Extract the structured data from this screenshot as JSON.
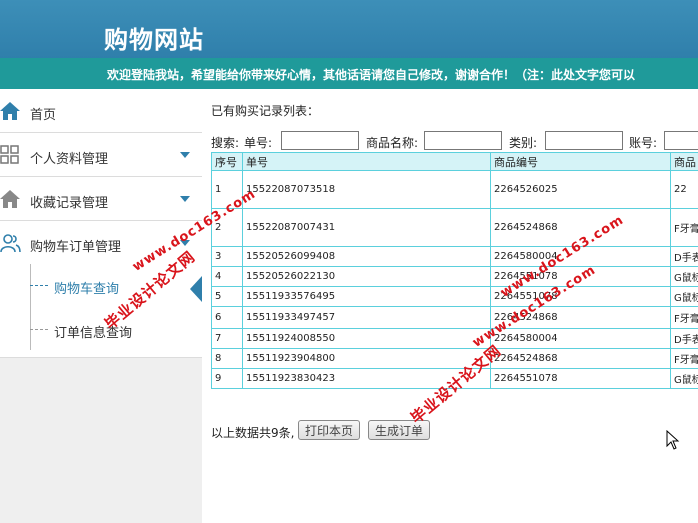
{
  "header": {
    "site_title": "购物网站"
  },
  "marquee": {
    "text": "欢迎登陆我站，希望能给你带来好心情，其他话语请您自己修改，谢谢合作！（注：此处文字您可以"
  },
  "sidebar": {
    "items": [
      {
        "label": "首页",
        "icon": "home-icon"
      },
      {
        "label": "个人资料管理",
        "icon": "grid-icon"
      },
      {
        "label": "收藏记录管理",
        "icon": "home-icon"
      },
      {
        "label": "购物车订单管理",
        "icon": "users-icon"
      }
    ],
    "sub_items": [
      {
        "label": "购物车查询",
        "active": true
      },
      {
        "label": "订单信息查询",
        "active": false
      }
    ]
  },
  "main": {
    "caption": "已有购买记录列表：",
    "search": {
      "prefix": "搜索:",
      "order_no_label": "单号:",
      "product_name_label": "商品名称:",
      "category_label": "类别:",
      "account_label": "账号:",
      "order_no_value": "",
      "product_name_value": "",
      "category_value": "",
      "account_value": ""
    },
    "table": {
      "headers": [
        "序号",
        "单号",
        "商品编号",
        "商品"
      ],
      "rows": [
        [
          "1",
          "15522087073518",
          "2264526025",
          "22"
        ],
        [
          "2",
          "15522087007431",
          "2264524868",
          "F牙膏"
        ],
        [
          "3",
          "15520526099408",
          "2264580004",
          "D手表"
        ],
        [
          "4",
          "15520526022130",
          "2264551078",
          "G鼠标"
        ],
        [
          "5",
          "15511933576495",
          "2264551078",
          "G鼠标"
        ],
        [
          "6",
          "15511933497457",
          "2264524868",
          "F牙膏"
        ],
        [
          "7",
          "15511924008550",
          "2264580004",
          "D手表"
        ],
        [
          "8",
          "15511923904800",
          "2264524868",
          "F牙膏"
        ],
        [
          "9",
          "15511923830423",
          "2264551078",
          "G鼠标"
        ]
      ]
    },
    "footer": {
      "count_text": "以上数据共9条,",
      "print_button": "打印本页",
      "order_button": "生成订单"
    }
  },
  "watermarks": [
    "毕业设计论文网",
    "www.doc163.com"
  ],
  "colors": {
    "header": "#2f7fab",
    "marquee": "#1f9a9a",
    "table_border": "#5bd0dd",
    "watermark": "#d9141b"
  }
}
